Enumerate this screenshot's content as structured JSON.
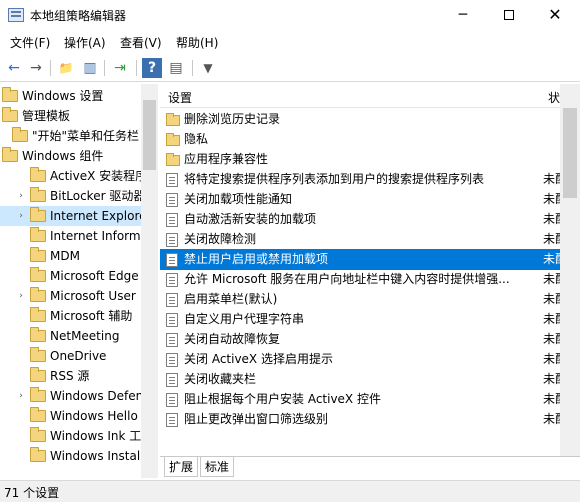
{
  "window": {
    "title": "本地组策略编辑器",
    "minimize": "─",
    "maximize": "",
    "close": "✕"
  },
  "menu": [
    "文件(F)",
    "操作(A)",
    "查看(V)",
    "帮助(H)"
  ],
  "toolbar": {
    "back": "←",
    "forward": "→",
    "up_folder": "📁",
    "show_hide": "▥",
    "export": "⇥",
    "help": "?",
    "properties": "▤",
    "filter": "▼"
  },
  "tree": [
    {
      "label": "Windows 设置",
      "indent": 0,
      "expander": "",
      "selected": false
    },
    {
      "label": "管理模板",
      "indent": 0,
      "expander": "",
      "selected": false
    },
    {
      "label": "\"开始\"菜单和任务栏",
      "indent": 1,
      "expander": "",
      "selected": false
    },
    {
      "label": "Windows 组件",
      "indent": 1,
      "expander": "⌄",
      "selected": false
    },
    {
      "label": "ActiveX 安装程序",
      "indent": 2,
      "expander": "",
      "selected": false
    },
    {
      "label": "BitLocker 驱动器",
      "indent": 2,
      "expander": "›",
      "selected": false
    },
    {
      "label": "Internet Explorer",
      "indent": 2,
      "expander": "›",
      "selected": true
    },
    {
      "label": "Internet Information",
      "indent": 2,
      "expander": "",
      "selected": false
    },
    {
      "label": "MDM",
      "indent": 2,
      "expander": "",
      "selected": false
    },
    {
      "label": "Microsoft Edge",
      "indent": 2,
      "expander": "",
      "selected": false
    },
    {
      "label": "Microsoft User",
      "indent": 2,
      "expander": "›",
      "selected": false
    },
    {
      "label": "Microsoft 辅助",
      "indent": 2,
      "expander": "",
      "selected": false
    },
    {
      "label": "NetMeeting",
      "indent": 2,
      "expander": "",
      "selected": false
    },
    {
      "label": "OneDrive",
      "indent": 2,
      "expander": "",
      "selected": false
    },
    {
      "label": "RSS 源",
      "indent": 2,
      "expander": "",
      "selected": false
    },
    {
      "label": "Windows Defender",
      "indent": 2,
      "expander": "›",
      "selected": false
    },
    {
      "label": "Windows Hello",
      "indent": 2,
      "expander": "",
      "selected": false
    },
    {
      "label": "Windows Ink 工作区",
      "indent": 2,
      "expander": "",
      "selected": false
    },
    {
      "label": "Windows Installer",
      "indent": 2,
      "expander": "",
      "selected": false
    }
  ],
  "list": {
    "col_setting": "设置",
    "col_status": "状",
    "rows": [
      {
        "type": "folder",
        "label": "删除浏览历史记录",
        "status": "",
        "selected": false
      },
      {
        "type": "folder",
        "label": "隐私",
        "status": "",
        "selected": false
      },
      {
        "type": "folder",
        "label": "应用程序兼容性",
        "status": "",
        "selected": false
      },
      {
        "type": "setting",
        "label": "将特定搜索提供程序列表添加到用户的搜索提供程序列表",
        "status": "未配",
        "selected": false
      },
      {
        "type": "setting",
        "label": "关闭加载项性能通知",
        "status": "未配",
        "selected": false
      },
      {
        "type": "setting",
        "label": "自动激活新安装的加载项",
        "status": "未配",
        "selected": false
      },
      {
        "type": "setting",
        "label": "关闭故障检测",
        "status": "未配",
        "selected": false
      },
      {
        "type": "setting",
        "label": "禁止用户启用或禁用加载项",
        "status": "未配",
        "selected": true
      },
      {
        "type": "setting",
        "label": "允许 Microsoft 服务在用户向地址栏中键入内容时提供增强...",
        "status": "未配",
        "selected": false
      },
      {
        "type": "setting",
        "label": "启用菜单栏(默认)",
        "status": "未配",
        "selected": false
      },
      {
        "type": "setting",
        "label": "自定义用户代理字符串",
        "status": "未配",
        "selected": false
      },
      {
        "type": "setting",
        "label": "关闭自动故障恢复",
        "status": "未配",
        "selected": false
      },
      {
        "type": "setting",
        "label": "关闭 ActiveX 选择启用提示",
        "status": "未配",
        "selected": false
      },
      {
        "type": "setting",
        "label": "关闭收藏夹栏",
        "status": "未配",
        "selected": false
      },
      {
        "type": "setting",
        "label": "阻止根据每个用户安装 ActiveX 控件",
        "status": "未配",
        "selected": false
      },
      {
        "type": "setting",
        "label": "阻止更改弹出窗口筛选级别",
        "status": "未配",
        "selected": false
      }
    ]
  },
  "tabs": [
    "扩展",
    "标准"
  ],
  "status": "71 个设置"
}
